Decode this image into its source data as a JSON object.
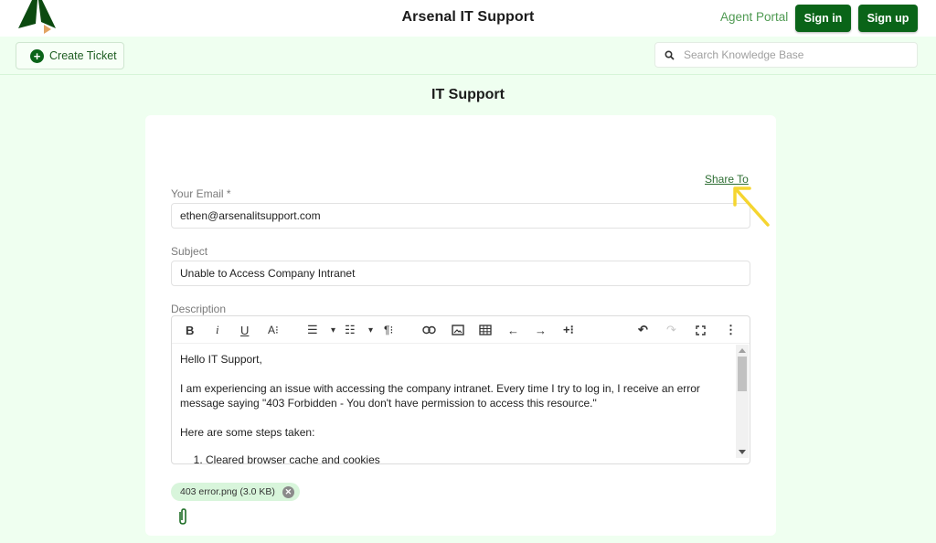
{
  "header": {
    "app_title": "Arsenal IT Support",
    "agent_portal_label": "Agent Portal",
    "signin_label": "Sign in",
    "signup_label": "Sign up",
    "brand_color": "#0a6418"
  },
  "subbar": {
    "create_ticket_label": "Create Ticket",
    "search_placeholder": "Search Knowledge Base",
    "search_value": ""
  },
  "page": {
    "heading": "IT Support"
  },
  "form": {
    "share_to_label": "Share To",
    "email_label": "Your Email *",
    "email_value": "ethen@arsenalitsupport.com",
    "subject_label": "Subject",
    "subject_value": "Unable to Access Company Intranet",
    "description_label": "Description",
    "toolbar": {
      "bold": "B",
      "italic": "i",
      "underline": "U",
      "font_size": "A⁝",
      "ordered_list": "☰",
      "ordered_dropdown": "▾",
      "unordered_list": "☷",
      "unordered_dropdown": "▾",
      "paragraph": "¶⁝",
      "link": "🔗",
      "image": "▣",
      "table": "⊞",
      "undo_step": "←",
      "redo_step": "→",
      "insert_more": "+⁝",
      "undo": "↶",
      "redo": "↷",
      "fullscreen": "⛶",
      "more": "⋮"
    },
    "description": {
      "greeting": "Hello IT Support,",
      "paragraph1": "I am experiencing an issue with accessing the company intranet. Every time I try to log in, I receive an error message saying \"403 Forbidden - You don't have permission to access this resource.\"",
      "paragraph2": "Here are some steps taken:",
      "steps": [
        "Cleared browser cache and cookies"
      ]
    },
    "attachment": {
      "name": "403 error.png (3.0 KB)"
    }
  },
  "annotation": {
    "arrow_color": "#f5d530"
  }
}
